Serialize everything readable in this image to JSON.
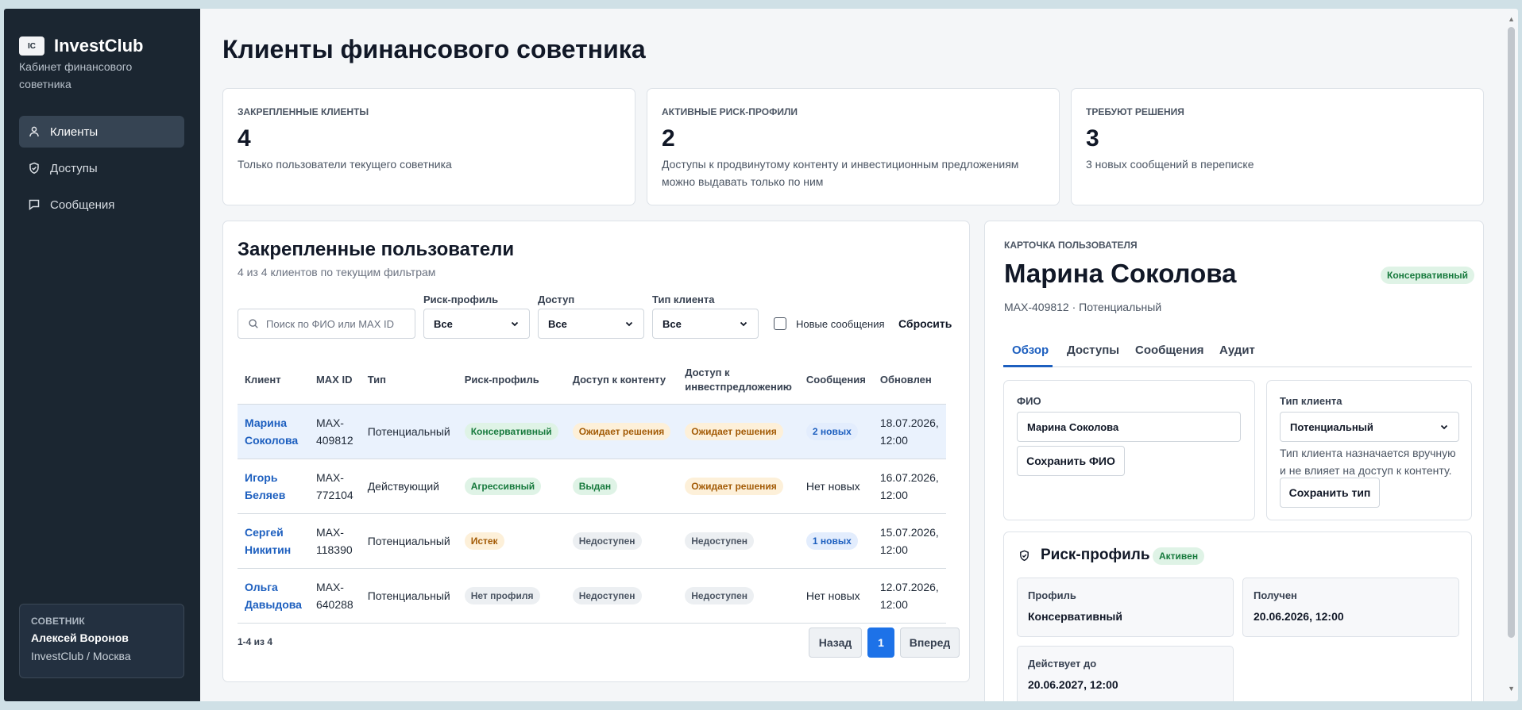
{
  "brand": {
    "logo_text": "IC",
    "name": "InvestClub",
    "subtitle": "Кабинет финансового советника"
  },
  "nav": [
    {
      "label": "Клиенты",
      "icon": "user-icon",
      "active": true
    },
    {
      "label": "Доступы",
      "icon": "shield-icon",
      "active": false
    },
    {
      "label": "Сообщения",
      "icon": "message-icon",
      "active": false
    }
  ],
  "advisor": {
    "label": "СОВЕТНИК",
    "name": "Алексей Воронов",
    "org": "InvestClub / Москва"
  },
  "page_title": "Клиенты финансового советника",
  "stats": [
    {
      "label": "ЗАКРЕПЛЕННЫЕ КЛИЕНТЫ",
      "value": "4",
      "desc": "Только пользователи текущего советника"
    },
    {
      "label": "АКТИВНЫЕ РИСК-ПРОФИЛИ",
      "value": "2",
      "desc": "Доступы к продвинутому контенту и инвестиционным предложениям можно выдавать только по ним"
    },
    {
      "label": "ТРЕБУЮТ РЕШЕНИЯ",
      "value": "3",
      "desc": "3 новых сообщений в переписке"
    }
  ],
  "clients_section": {
    "title": "Закрепленные пользователи",
    "subtitle": "4 из 4 клиентов по текущим фильтрам",
    "search_placeholder": "Поиск по ФИО или MAX ID",
    "filters": {
      "risk_label": "Риск-профиль",
      "risk_value": "Все",
      "access_label": "Доступ",
      "access_value": "Все",
      "type_label": "Тип клиента",
      "type_value": "Все",
      "new_messages_label": "Новые сообщения",
      "reset_label": "Сбросить"
    },
    "columns": [
      "Клиент",
      "MAX ID",
      "Тип",
      "Риск-профиль",
      "Доступ к контенту",
      "Доступ к инвестпредложению",
      "Сообщения",
      "Обновлен"
    ],
    "rows": [
      {
        "client": "Марина Соколова",
        "max_id": "MAX-409812",
        "type": "Потенциальный",
        "risk": "Консервативный",
        "risk_tone": "green",
        "content": "Ожидает решения",
        "content_tone": "amber",
        "invest": "Ожидает решения",
        "invest_tone": "amber",
        "messages": "2 новых",
        "messages_tone": "blue",
        "updated": "18.07.2026, 12:00",
        "selected": true
      },
      {
        "client": "Игорь Беляев",
        "max_id": "MAX-772104",
        "type": "Действующий",
        "risk": "Агрессивный",
        "risk_tone": "green",
        "content": "Выдан",
        "content_tone": "green",
        "invest": "Ожидает решения",
        "invest_tone": "amber",
        "messages": "Нет новых",
        "messages_tone": "",
        "updated": "16.07.2026, 12:00",
        "selected": false
      },
      {
        "client": "Сергей Никитин",
        "max_id": "MAX-118390",
        "type": "Потенциальный",
        "risk": "Истек",
        "risk_tone": "amber",
        "content": "Недоступен",
        "content_tone": "gray",
        "invest": "Недоступен",
        "invest_tone": "gray",
        "messages": "1 новых",
        "messages_tone": "blue",
        "updated": "15.07.2026, 12:00",
        "selected": false
      },
      {
        "client": "Ольга Давыдова",
        "max_id": "MAX-640288",
        "type": "Потенциальный",
        "risk": "Нет профиля",
        "risk_tone": "gray",
        "content": "Недоступен",
        "content_tone": "gray",
        "invest": "Недоступен",
        "invest_tone": "gray",
        "messages": "Нет новых",
        "messages_tone": "",
        "updated": "12.07.2026, 12:00",
        "selected": false
      }
    ],
    "pagination": {
      "range": "1-4 из 4",
      "prev": "Назад",
      "current": "1",
      "next": "Вперед"
    }
  },
  "user_card": {
    "label": "КАРТОЧКА ПОЛЬЗОВАТЕЛЯ",
    "name": "Марина Соколова",
    "badge": "Консервативный",
    "meta": "MAX-409812 · Потенциальный",
    "tabs": [
      "Обзор",
      "Доступы",
      "Сообщения",
      "Аудит"
    ],
    "fio_label": "ФИО",
    "fio_value": "Марина Соколова",
    "save_fio": "Сохранить ФИО",
    "type_label": "Тип клиента",
    "type_value": "Потенциальный",
    "type_hint": "Тип клиента назначается вручную и не влияет на доступ к контенту.",
    "save_type": "Сохранить тип",
    "risk": {
      "title": "Риск-профиль",
      "status": "Активен",
      "profile_label": "Профиль",
      "profile_value": "Консервативный",
      "received_label": "Получен",
      "received_value": "20.06.2026, 12:00",
      "valid_label": "Действует до",
      "valid_value": "20.06.2027, 12:00"
    }
  },
  "colors": {
    "sidebar": "#1b2631",
    "accent": "#1d72e8",
    "link": "#1d5fbf"
  }
}
